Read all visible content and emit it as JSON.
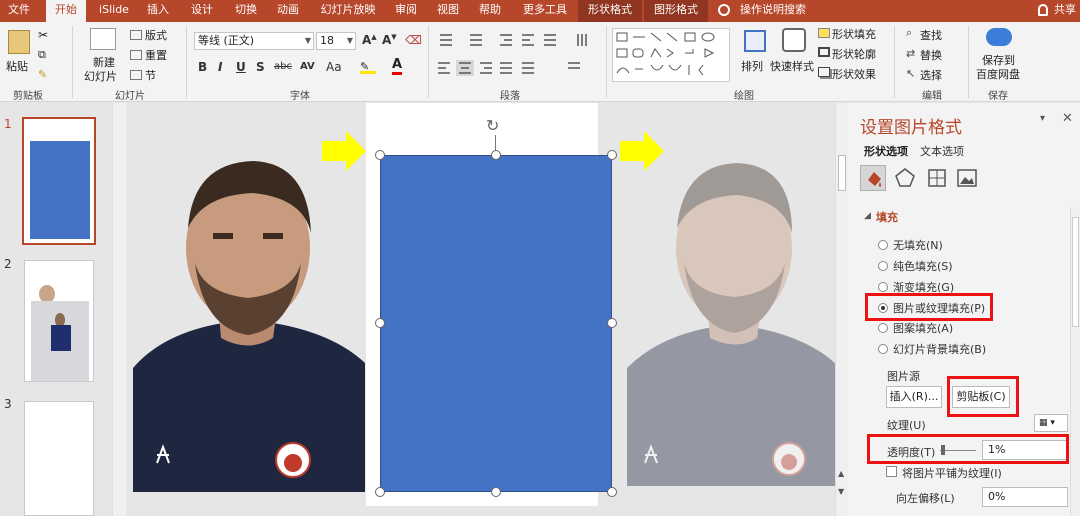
{
  "tabs": [
    "文件",
    "开始",
    "iSlide",
    "插入",
    "设计",
    "切换",
    "动画",
    "幻灯片放映",
    "审阅",
    "视图",
    "帮助",
    "更多工具",
    "形状格式",
    "图形格式",
    "操作说明搜索",
    "共享"
  ],
  "ribbon": {
    "clipboard": {
      "paste": "粘贴",
      "label": "剪贴板"
    },
    "slides": {
      "new_slide_1": "新建",
      "new_slide_2": "幻灯片",
      "layout": "版式",
      "reset": "重置",
      "section": "节",
      "label": "幻灯片"
    },
    "font": {
      "name": "等线 (正文)",
      "size": "18",
      "label": "字体",
      "bold": "B",
      "italic": "I",
      "underline": "U",
      "shadow": "S",
      "strike": "abc",
      "spacing": "AV",
      "case": "Aa"
    },
    "paragraph": {
      "label": "段落"
    },
    "drawing": {
      "arrange": "排列",
      "quick_styles": "快速样式",
      "shape_fill": "形状填充",
      "shape_outline": "形状轮廓",
      "shape_effects": "形状效果",
      "label": "绘图"
    },
    "editing": {
      "find": "查找",
      "replace": "替换",
      "select": "选择",
      "label": "编辑"
    },
    "save": {
      "line1": "保存到",
      "line2": "百度网盘",
      "label": "保存"
    }
  },
  "thumbnails": [
    "1",
    "2",
    "3"
  ],
  "pane": {
    "title": "设置图片格式",
    "tab_shape": "形状选项",
    "tab_text": "文本选项",
    "fill_header": "填充",
    "options": [
      "无填充(N)",
      "纯色填充(S)",
      "渐变填充(G)",
      "图片或纹理填充(P)",
      "图案填充(A)",
      "幻灯片背景填充(B)"
    ],
    "selected_option": 3,
    "picture_source": "图片源",
    "insert_btn": "插入(R)...",
    "clipboard_btn": "剪贴板(C)",
    "texture": "纹理(U)",
    "transparency_label": "透明度(T)",
    "transparency_value": "1%",
    "tile_label": "将图片平铺为纹理(I)",
    "offset_left_label": "向左偏移(L)",
    "offset_left_value": "0%"
  },
  "colors": {
    "accent": "#b7472a",
    "shape_blue": "#4472c4",
    "arrow_yellow": "#ffff00",
    "highlight_red": "#e11111"
  },
  "slide": {
    "transparency_preview": 0.6
  }
}
